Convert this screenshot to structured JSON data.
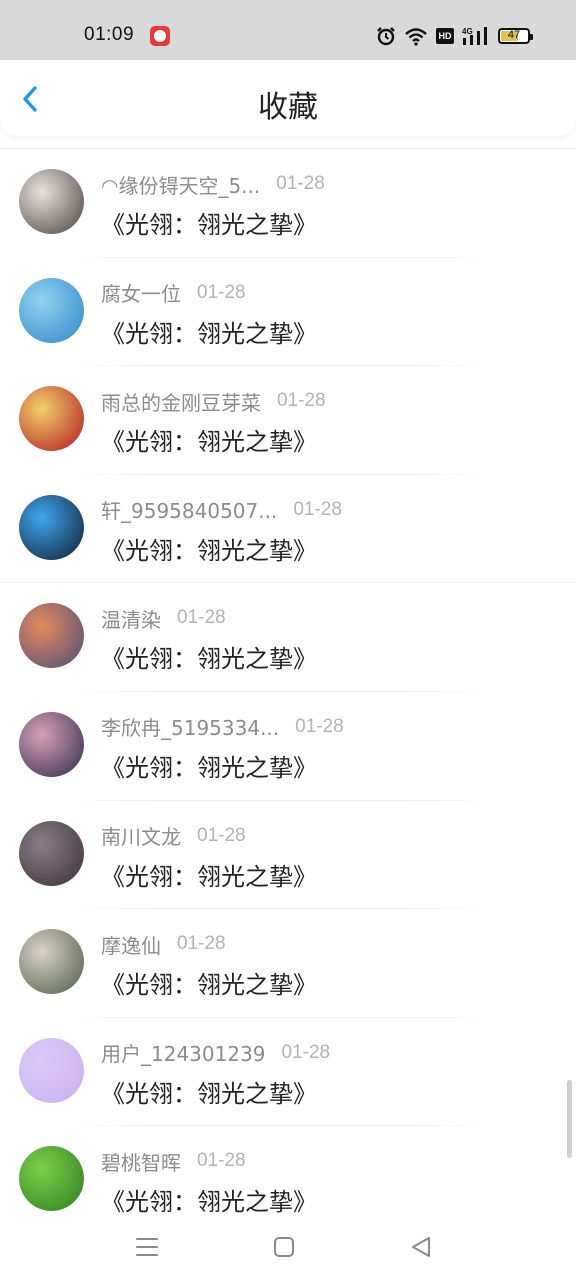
{
  "status_bar": {
    "time": "01:09",
    "battery": "47",
    "network_badge": "HD",
    "signal_label": "4G",
    "icons": [
      "app-notification-icon",
      "alarm-icon",
      "wifi-icon",
      "hd-icon",
      "signal-icon",
      "battery-icon"
    ]
  },
  "header": {
    "title": "收藏",
    "back_icon": "chevron-left-icon",
    "accent_color": "#1a9be6"
  },
  "items": [
    {
      "name": "◠缘份锝天空_5...",
      "date": "01-28",
      "title": "《光翎：翎光之挚》",
      "avatar_colors": [
        "#e8e3df",
        "#4a403b"
      ]
    },
    {
      "name": "腐女一位",
      "date": "01-28",
      "title": "《光翎：翎光之挚》",
      "avatar_colors": [
        "#8fd3f0",
        "#2f86c9"
      ]
    },
    {
      "name": "雨总的金刚豆芽菜",
      "date": "01-28",
      "title": "《光翎：翎光之挚》",
      "avatar_colors": [
        "#f2d16b",
        "#b0141c"
      ]
    },
    {
      "name": "轩_9595840507...",
      "date": "01-28",
      "title": "《光翎：翎光之挚》",
      "avatar_colors": [
        "#3fa6ee",
        "#0f1b2e"
      ]
    },
    {
      "name": "温清染",
      "date": "01-28",
      "title": "《光翎：翎光之挚》",
      "avatar_colors": [
        "#e48a5b",
        "#4d4d7a"
      ]
    },
    {
      "name": "李欣冉_5195334...",
      "date": "01-28",
      "title": "《光翎：翎光之挚》",
      "avatar_colors": [
        "#d7a0b8",
        "#2f2a4a"
      ]
    },
    {
      "name": "南川文龙",
      "date": "01-28",
      "title": "《光翎：翎光之挚》",
      "avatar_colors": [
        "#8a7d86",
        "#3b3038"
      ]
    },
    {
      "name": "摩逸仙",
      "date": "01-28",
      "title": "《光翎：翎光之挚》",
      "avatar_colors": [
        "#d9d3c5",
        "#4e5a47"
      ]
    },
    {
      "name": "用户_124301239",
      "date": "01-28",
      "title": "《光翎：翎光之挚》",
      "avatar_colors": [
        "#dcc9f5",
        "#c9b0ef"
      ]
    },
    {
      "name": "碧桃智晖",
      "date": "01-28",
      "title": "《光翎：翎光之挚》",
      "avatar_colors": [
        "#7ccf4a",
        "#2e7d1f"
      ]
    }
  ],
  "nav": {
    "icons": [
      "menu-icon",
      "home-square-icon",
      "back-triangle-icon"
    ]
  }
}
